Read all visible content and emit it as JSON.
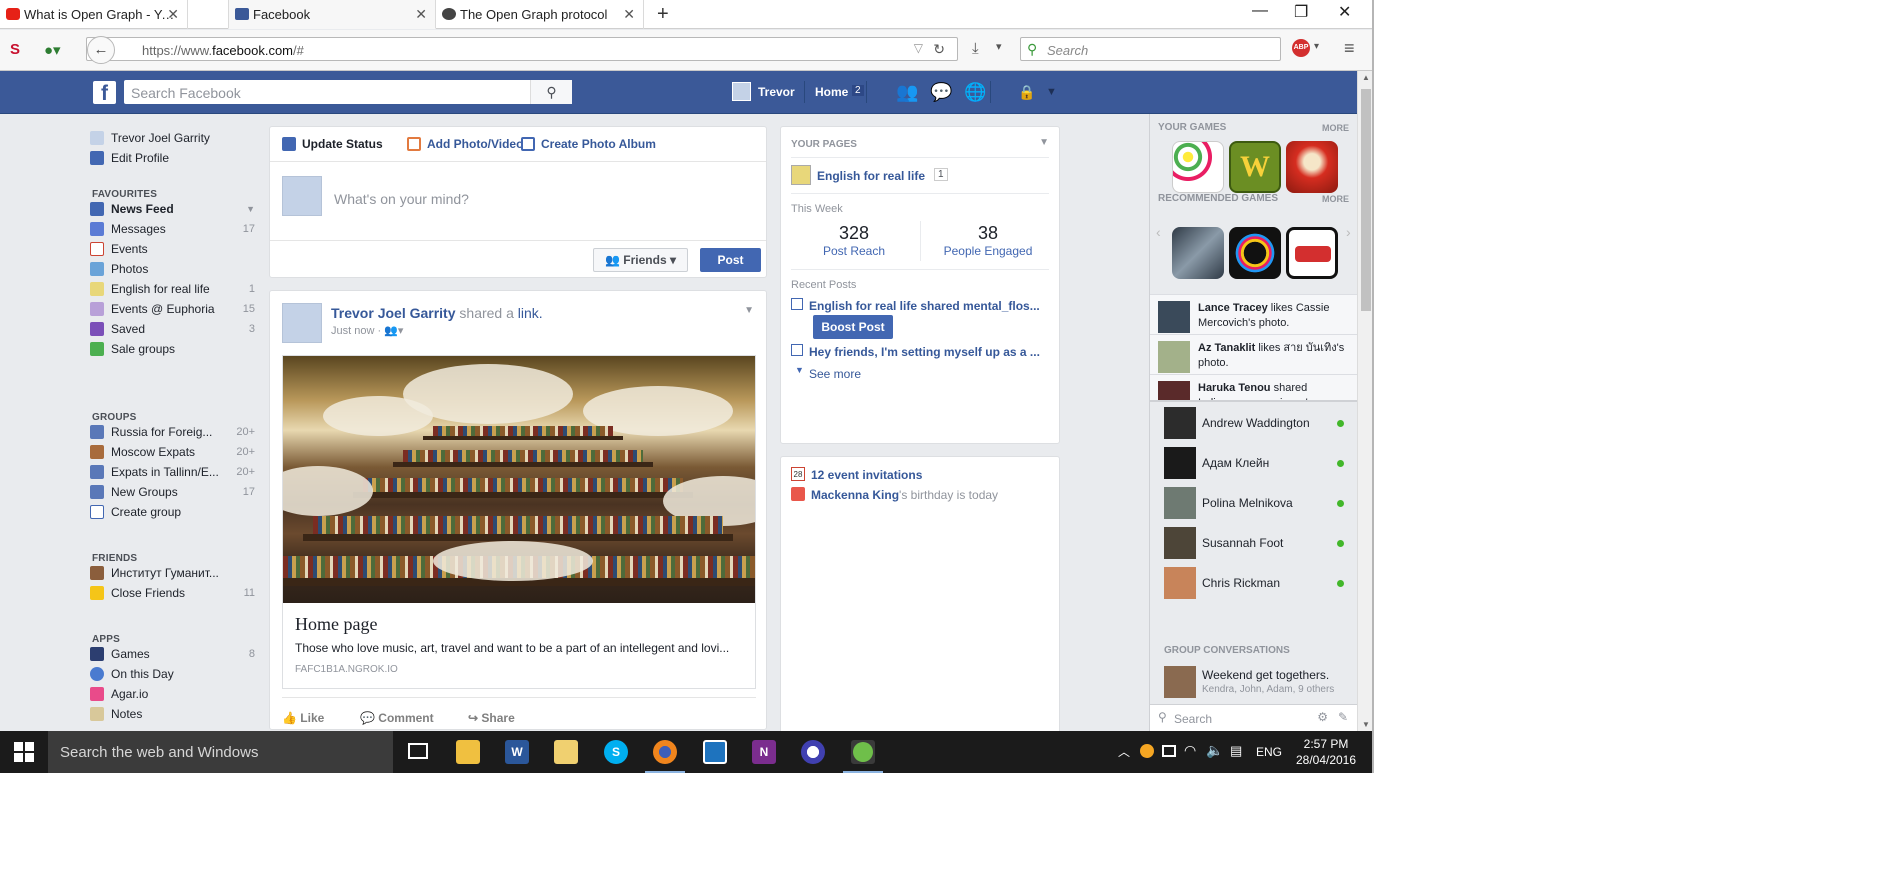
{
  "browser": {
    "tabs": [
      {
        "label": "What is Open Graph - You...",
        "active": false
      },
      {
        "label": "Facebook",
        "active": true
      },
      {
        "label": "The Open Graph protocol",
        "active": false
      }
    ],
    "url_prefix": "https://www.",
    "url_domain": "facebook.com",
    "url_suffix": "/#",
    "search_placeholder": "Search"
  },
  "fb_header": {
    "search_placeholder": "Search Facebook",
    "profile_name": "Trevor",
    "home_label": "Home",
    "home_count": "2"
  },
  "left_nav": {
    "profile_name": "Trevor Joel Garrity",
    "edit_profile": "Edit Profile",
    "favourites_title": "FAVOURITES",
    "favourites": [
      {
        "label": "News Feed",
        "count": ""
      },
      {
        "label": "Messages",
        "count": "17"
      },
      {
        "label": "Events",
        "count": ""
      },
      {
        "label": "Photos",
        "count": ""
      },
      {
        "label": "English for real life",
        "count": "1"
      },
      {
        "label": "Events @ Euphoria",
        "count": "15"
      },
      {
        "label": "Saved",
        "count": "3"
      },
      {
        "label": "Sale groups",
        "count": ""
      }
    ],
    "groups_title": "GROUPS",
    "groups": [
      {
        "label": "Russia for Foreig...",
        "count": "20+"
      },
      {
        "label": "Moscow Expats",
        "count": "20+"
      },
      {
        "label": "Expats in Tallinn/E...",
        "count": "20+"
      },
      {
        "label": "New Groups",
        "count": "17"
      },
      {
        "label": "Create group",
        "count": ""
      }
    ],
    "friends_title": "FRIENDS",
    "friends": [
      {
        "label": "Институт Гуманит...",
        "count": ""
      },
      {
        "label": "Close Friends",
        "count": "11"
      }
    ],
    "apps_title": "APPS",
    "apps": [
      {
        "label": "Games",
        "count": "8"
      },
      {
        "label": "On this Day",
        "count": ""
      },
      {
        "label": "Agar.io",
        "count": ""
      },
      {
        "label": "Notes",
        "count": ""
      }
    ]
  },
  "composer": {
    "tab_status": "Update Status",
    "tab_photo": "Add Photo/Video",
    "tab_album": "Create Photo Album",
    "placeholder": "What's on your mind?",
    "audience": "Friends",
    "post": "Post"
  },
  "story": {
    "author": "Trevor Joel Garrity",
    "verb": "shared a",
    "object": "link.",
    "time": "Just now ·",
    "link_title": "Home page",
    "link_desc": "Those who love music, art, travel and want to be a part of an intellegent and lovi...",
    "link_domain": "FAFC1B1A.NGROK.IO",
    "like": "Like",
    "comment": "Comment",
    "share": "Share"
  },
  "pages_panel": {
    "title": "YOUR PAGES",
    "page_name": "English for real life",
    "page_badge": "1",
    "this_week": "This Week",
    "post_reach_value": "328",
    "post_reach_label": "Post Reach",
    "engaged_value": "38",
    "engaged_label": "People Engaged",
    "recent_posts": "Recent Posts",
    "post1": "English for real life shared mental_flos...",
    "boost": "Boost Post",
    "post2": "Hey friends, I'm setting myself up as a ...",
    "see_more": "See more"
  },
  "events_panel": {
    "invitations": "12 event invitations",
    "birthday_name": "Mackenna King",
    "birthday_rest": "'s birthday is today"
  },
  "right_sidebar": {
    "your_games": "YOUR GAMES",
    "recommended_games": "RECOMMENDED GAMES",
    "more": "MORE",
    "ticker": [
      {
        "name": "Lance Tracey",
        "text": " likes Cassie Mercovich's photo."
      },
      {
        "name": "Az Tanaklit",
        "text": " likes สาย บันเทิง's photo."
      },
      {
        "name": "Haruka Tenou",
        "text": " shared Indigenous americans's"
      }
    ],
    "chat": [
      {
        "name": "Andrew Waddington"
      },
      {
        "name": "Адам Клейн"
      },
      {
        "name": "Polina Melnikova"
      },
      {
        "name": "Susannah Foot"
      },
      {
        "name": "Chris Rickman"
      }
    ],
    "group_conversations": "GROUP CONVERSATIONS",
    "group_name": "Weekend get togethers.",
    "group_members": "Kendra, John, Adam, 9 others",
    "chat_search": "Search"
  },
  "taskbar": {
    "search": "Search the web and Windows",
    "lang": "ENG",
    "time": "2:57 PM",
    "date": "28/04/2016"
  },
  "colors": {
    "fb_blue": "#3b5998",
    "link_blue": "#365899",
    "online_green": "#42b72a"
  }
}
